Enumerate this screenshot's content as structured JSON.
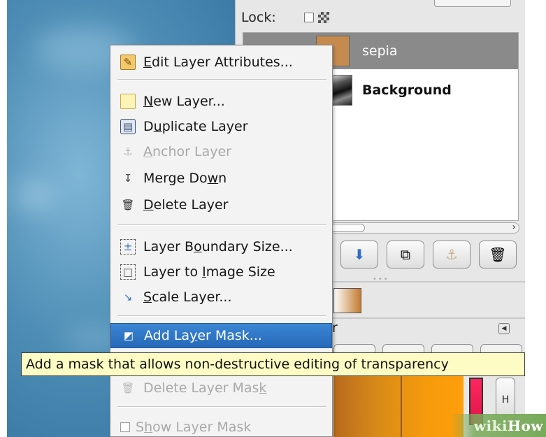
{
  "dock": {
    "lock_label": "Lock:",
    "layers": [
      {
        "name": "sepia",
        "selected": true
      },
      {
        "name": "Background",
        "selected": false
      }
    ],
    "partial_label": "r",
    "side_button": "H"
  },
  "menu": {
    "items": [
      {
        "pre": "",
        "ul": "E",
        "post": "dit Layer Attributes...",
        "icon": "edit-attributes-icon",
        "disabled": false
      },
      {
        "pre": "",
        "ul": "N",
        "post": "ew Layer...",
        "icon": "new-layer-icon",
        "disabled": false
      },
      {
        "pre": "D",
        "ul": "u",
        "post": "plicate Layer",
        "icon": "duplicate-layer-icon",
        "disabled": false
      },
      {
        "pre": "",
        "ul": "A",
        "post": "nchor Layer",
        "icon": "anchor-icon",
        "disabled": true
      },
      {
        "pre": "Merge Do",
        "ul": "w",
        "post": "n",
        "icon": "merge-down-icon",
        "disabled": false
      },
      {
        "pre": "",
        "ul": "D",
        "post": "elete Layer",
        "icon": "trash-icon",
        "disabled": false
      },
      {
        "pre": "Layer B",
        "ul": "o",
        "post": "undary Size...",
        "icon": "layer-boundary-icon",
        "disabled": false
      },
      {
        "pre": "Layer to ",
        "ul": "I",
        "post": "mage Size",
        "icon": "layer-to-image-icon",
        "disabled": false
      },
      {
        "pre": "",
        "ul": "S",
        "post": "cale Layer...",
        "icon": "scale-layer-icon",
        "disabled": false
      },
      {
        "pre": "Add La",
        "ul": "y",
        "post": "er Mask...",
        "icon": "layer-mask-icon",
        "disabled": false,
        "highlighted": true
      },
      {
        "pre": "Delete Layer Mas",
        "ul": "k",
        "post": "",
        "icon": "trash-icon",
        "disabled": true
      },
      {
        "pre": "S",
        "ul": "h",
        "post": "ow Layer Mask",
        "icon": "checkbox-icon",
        "disabled": true
      }
    ]
  },
  "tooltip": {
    "text": "Add a mask that allows non-destructive editing of transparency"
  },
  "watermark": {
    "wiki": "wiki",
    "how": "How"
  },
  "colors": {
    "highlight": "#2f77c7",
    "tooltip_bg": "#fdfcc4",
    "sepia_thumb": "#c58a4e",
    "fg_color": "#f0245a"
  }
}
